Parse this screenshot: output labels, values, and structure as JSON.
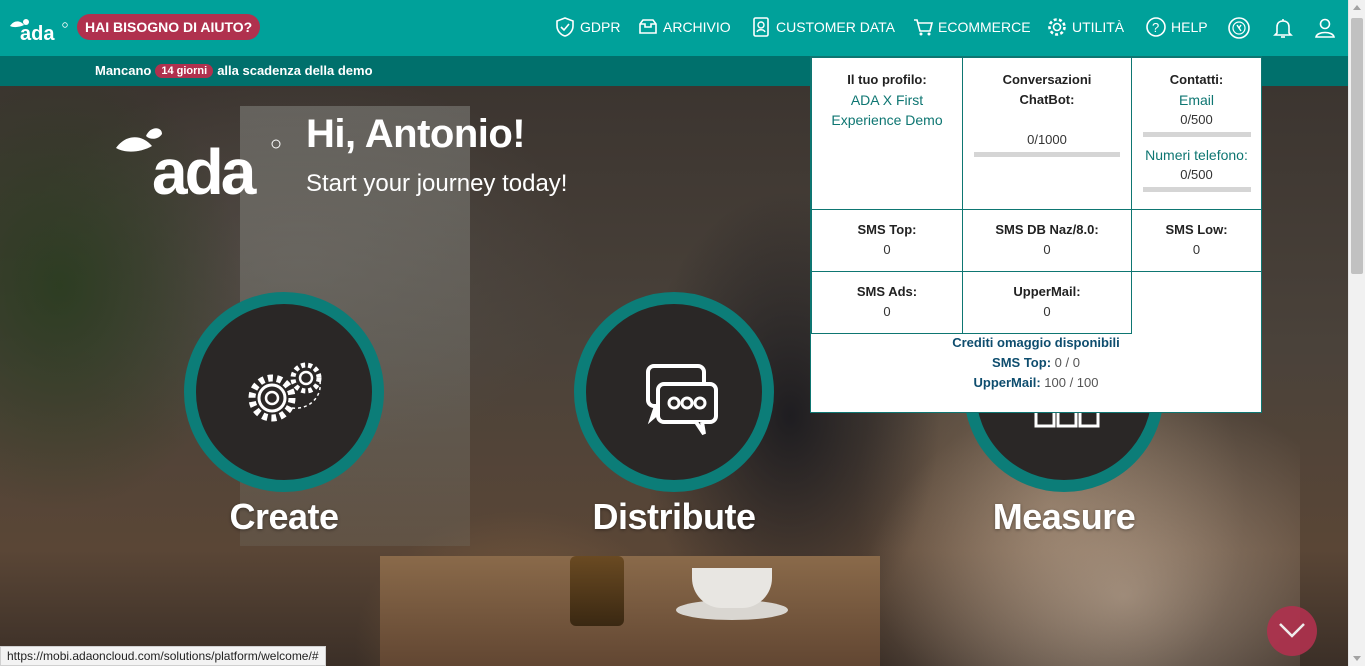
{
  "topbar": {
    "help_label": "HAI BISOGNO DI AIUTO?",
    "nav": [
      {
        "label": "GDPR",
        "icon": "shield-check-icon"
      },
      {
        "label": "ARCHIVIO",
        "icon": "archive-icon"
      },
      {
        "label": "CUSTOMER DATA",
        "icon": "id-card-icon"
      },
      {
        "label": "ECOMMERCE",
        "icon": "cart-icon"
      },
      {
        "label": "UTILITÀ",
        "icon": "gear-icon"
      },
      {
        "label": "HELP",
        "icon": "question-icon"
      }
    ],
    "right_icons": [
      "credits-icon",
      "bell-icon",
      "user-icon"
    ],
    "accent": "#00a19a"
  },
  "demobar": {
    "prefix": "Mancano",
    "days": "14 giorni",
    "suffix": "alla scadenza della demo"
  },
  "hero": {
    "title": "Hi, Antonio!",
    "subtitle": "Start your journey today!",
    "cards": [
      {
        "label": "Create",
        "icon": "gears-icon"
      },
      {
        "label": "Distribute",
        "icon": "chat-bubbles-icon"
      },
      {
        "label": "Measure",
        "icon": "chart-icon"
      }
    ]
  },
  "panel": {
    "profile": {
      "label": "Il tuo profilo:",
      "value": "ADA X First Experience Demo"
    },
    "chatbot": {
      "label": "Conversazioni ChatBot:",
      "value": "0/1000",
      "used_fraction": 0.0
    },
    "contacts": {
      "label": "Contatti:",
      "email_label": "Email",
      "email_value": "0/500",
      "email_fraction": 0.0,
      "phone_label": "Numeri telefono:",
      "phone_value": "0/500",
      "phone_fraction": 0.0
    },
    "sms_top": {
      "label": "SMS Top:",
      "value": "0"
    },
    "sms_db": {
      "label": "SMS DB Naz/8.0:",
      "value": "0"
    },
    "sms_low": {
      "label": "SMS Low:",
      "value": "0"
    },
    "sms_ads": {
      "label": "SMS Ads:",
      "value": "0"
    },
    "uppermail": {
      "label": "UpperMail:",
      "value": "0"
    },
    "gift": {
      "heading": "Crediti omaggio disponibili",
      "sms_label": "SMS Top:",
      "sms_value": "0 / 0",
      "mail_label": "UpperMail:",
      "mail_value": "100 / 100"
    }
  },
  "status_url": "https://mobi.adaoncloud.com/solutions/platform/welcome/#"
}
